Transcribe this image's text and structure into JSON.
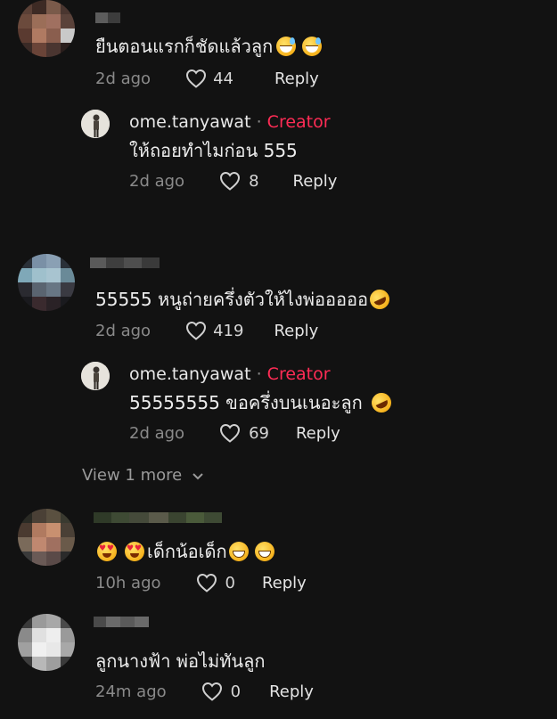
{
  "comments": [
    {
      "text": "ยืนตอนแรกก็ชัดแล้วลูก",
      "emojis": [
        "sweat-smile-emoji",
        "sweat-smile-emoji"
      ],
      "time": "2d ago",
      "likes": "44",
      "reply_label": "Reply",
      "replies": [
        {
          "author": "ome.tanyawat",
          "separator": "·",
          "badge": "Creator",
          "text": "ให้ถอยทำไมก่อน 555",
          "time": "2d ago",
          "likes": "8",
          "reply_label": "Reply"
        }
      ]
    },
    {
      "text": "55555 หนูถ่ายครึ่งตัวให้ไงพ่อออออ",
      "emojis": [
        "rofl-emoji"
      ],
      "time": "2d ago",
      "likes": "419",
      "reply_label": "Reply",
      "replies": [
        {
          "author": "ome.tanyawat",
          "separator": "·",
          "badge": "Creator",
          "text": "55555555 ขอครึ่งบนเนอะลูก",
          "time": "2d ago",
          "likes": "69",
          "reply_label": "Reply"
        }
      ],
      "view_more": "View 1 more"
    },
    {
      "text": "เด็กน้อเด็ก",
      "emojis": [
        "heart-eyes-emoji",
        "heart-eyes-emoji",
        "grin-emoji",
        "grin-emoji"
      ],
      "time": "10h ago",
      "likes": "0",
      "reply_label": "Reply"
    },
    {
      "text": "ลูกนางฟ้า พ่อไม่ทันลูก",
      "time": "24m ago",
      "likes": "0",
      "reply_label": "Reply"
    }
  ],
  "colors": {
    "background": "#121212",
    "creator_badge": "#fe2c55",
    "meta_text": "#8a8a8a"
  }
}
